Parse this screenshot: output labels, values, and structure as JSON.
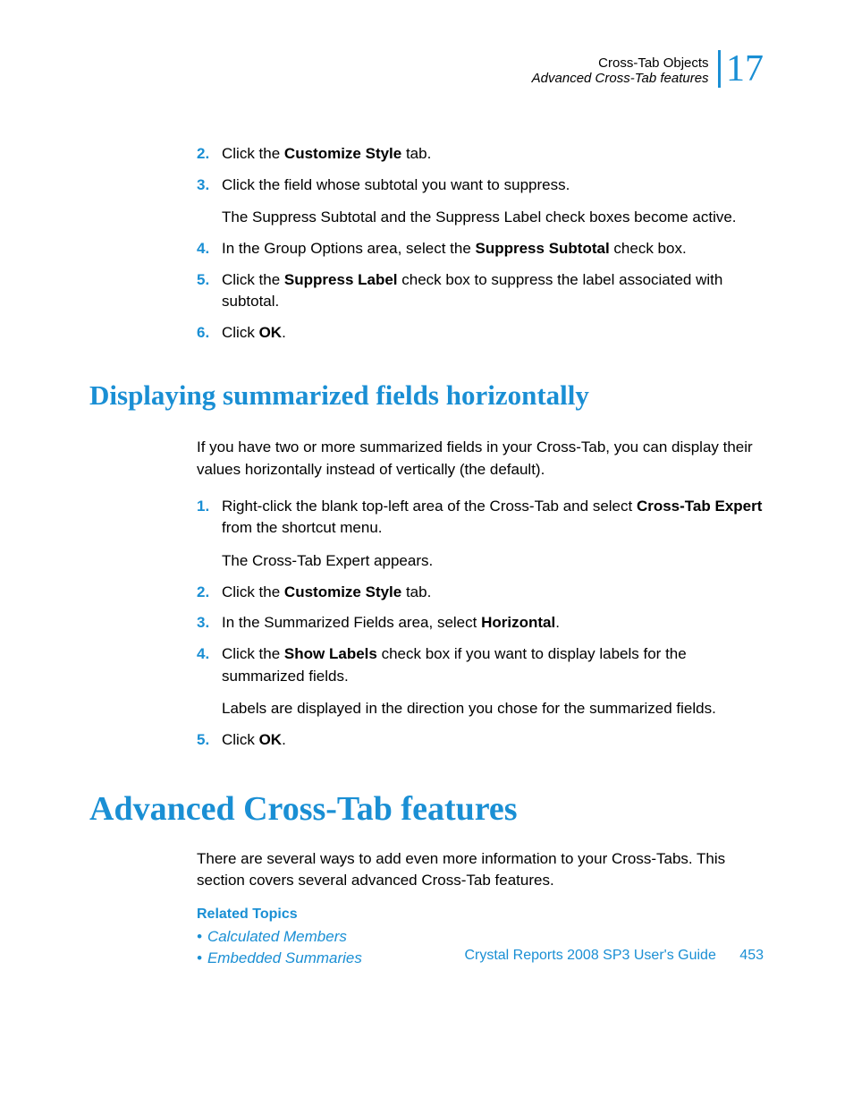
{
  "header": {
    "title": "Cross-Tab Objects",
    "subtitle": "Advanced Cross-Tab features",
    "chapter": "17"
  },
  "section1": {
    "steps": [
      {
        "num": "2.",
        "pre": "Click the ",
        "bold": "Customize Style",
        "post": " tab."
      },
      {
        "num": "3.",
        "text": "Click the field whose subtotal you want to suppress.",
        "note": "The Suppress Subtotal and the Suppress Label check boxes become active."
      },
      {
        "num": "4.",
        "pre": "In the Group Options area, select the ",
        "bold": "Suppress Subtotal",
        "post": " check box."
      },
      {
        "num": "5.",
        "pre": "Click the ",
        "bold": "Suppress Label",
        "post": " check box to suppress the label associated with subtotal."
      },
      {
        "num": "6.",
        "pre": "Click ",
        "bold": "OK",
        "post": "."
      }
    ]
  },
  "section2": {
    "heading": "Displaying summarized fields horizontally",
    "intro": "If you have two or more summarized fields in your Cross-Tab, you can display their values horizontally instead of vertically (the default).",
    "steps": [
      {
        "num": "1.",
        "pre": "Right-click the blank top-left area of the Cross-Tab and select ",
        "bold": "Cross-Tab Expert",
        "post": " from the shortcut menu.",
        "note": "The Cross-Tab Expert appears."
      },
      {
        "num": "2.",
        "pre": "Click the ",
        "bold": "Customize Style",
        "post": " tab."
      },
      {
        "num": "3.",
        "pre": "In the Summarized Fields area, select ",
        "bold": "Horizontal",
        "post": "."
      },
      {
        "num": "4.",
        "pre": "Click the ",
        "bold": "Show Labels",
        "post": " check box if you want to display labels for the summarized fields.",
        "note": "Labels are displayed in the direction you chose for the summarized fields."
      },
      {
        "num": "5.",
        "pre": "Click ",
        "bold": "OK",
        "post": "."
      }
    ]
  },
  "section3": {
    "heading": "Advanced Cross-Tab features",
    "intro": "There are several ways to add even more information to your Cross-Tabs. This section covers several advanced Cross-Tab features.",
    "related_heading": "Related Topics",
    "related": [
      "Calculated Members",
      "Embedded Summaries"
    ]
  },
  "footer": {
    "guide": "Crystal Reports 2008 SP3 User's Guide",
    "page": "453"
  }
}
